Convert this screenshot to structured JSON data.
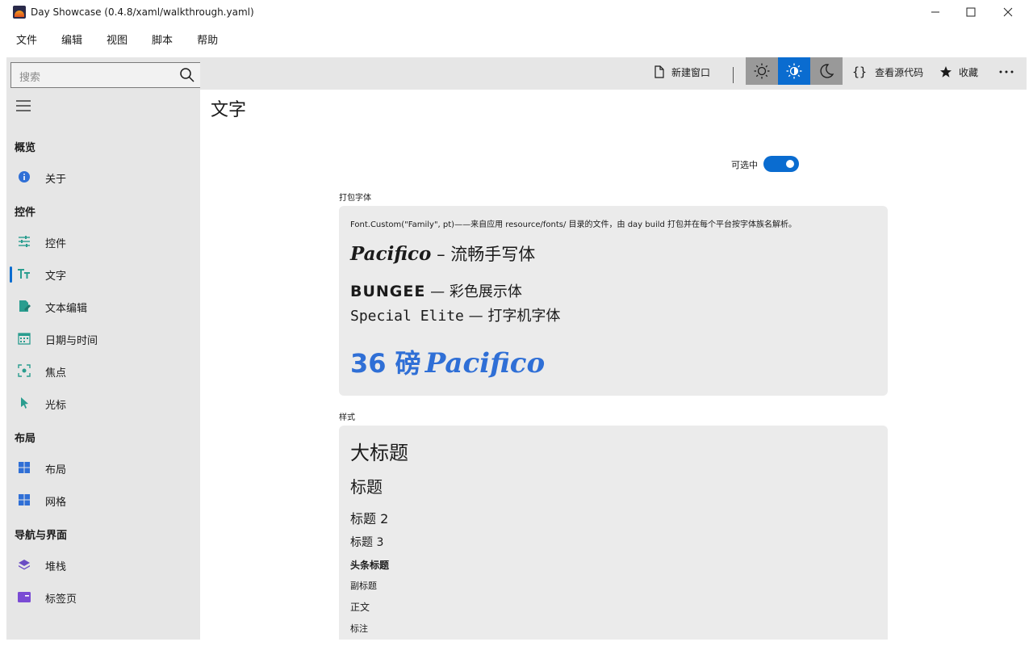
{
  "window": {
    "title": "Day Showcase (0.4.8/xaml/walkthrough.yaml)"
  },
  "menu": [
    "文件",
    "编辑",
    "视图",
    "脚本",
    "帮助"
  ],
  "search": {
    "placeholder": "搜索"
  },
  "sidebar": {
    "groups": [
      {
        "header": "概览",
        "items": [
          {
            "label": "关于",
            "icon": "info-icon"
          }
        ]
      },
      {
        "header": "控件",
        "items": [
          {
            "label": "控件",
            "icon": "sliders-icon"
          },
          {
            "label": "文字",
            "icon": "text-icon",
            "selected": true
          },
          {
            "label": "文本编辑",
            "icon": "edit-doc-icon"
          },
          {
            "label": "日期与时间",
            "icon": "calendar-icon"
          },
          {
            "label": "焦点",
            "icon": "focus-icon"
          },
          {
            "label": "光标",
            "icon": "cursor-icon"
          }
        ]
      },
      {
        "header": "布局",
        "items": [
          {
            "label": "布局",
            "icon": "grid-icon"
          },
          {
            "label": "网格",
            "icon": "grid-icon"
          }
        ]
      },
      {
        "header": "导航与界面",
        "items": [
          {
            "label": "堆栈",
            "icon": "layers-icon"
          },
          {
            "label": "标签页",
            "icon": "tab-icon"
          }
        ]
      }
    ]
  },
  "toolbar": {
    "new_window": "新建窗口",
    "view_source": "查看源代码",
    "favorite": "收藏"
  },
  "page": {
    "title": "文字",
    "selectable_label": "可选中",
    "selectable_on": true,
    "bundled_section": "打包字体",
    "bundled_desc": "Font.Custom(\"Family\", pt)——来自应用 resource/fonts/ 目录的文件，由 day build 打包并在每个平台按字体族名解析。",
    "fonts": [
      {
        "name": "Pacifico",
        "desc": " – 流畅手写体"
      },
      {
        "name": "BUNGEE",
        "desc": " — 彩色展示体"
      },
      {
        "name": "Special Elite",
        "desc": " — 打字机字体"
      }
    ],
    "size_sample": {
      "size": "36 磅",
      "name": "Pacifico"
    },
    "styles_section": "样式",
    "styles": [
      "大标题",
      "标题",
      "标题 2",
      "标题 3",
      "头条标题",
      "副标题",
      "正文",
      "标注"
    ]
  },
  "colors": {
    "accent": "#0a6cd0",
    "sample_blue": "#2f6fd6"
  }
}
